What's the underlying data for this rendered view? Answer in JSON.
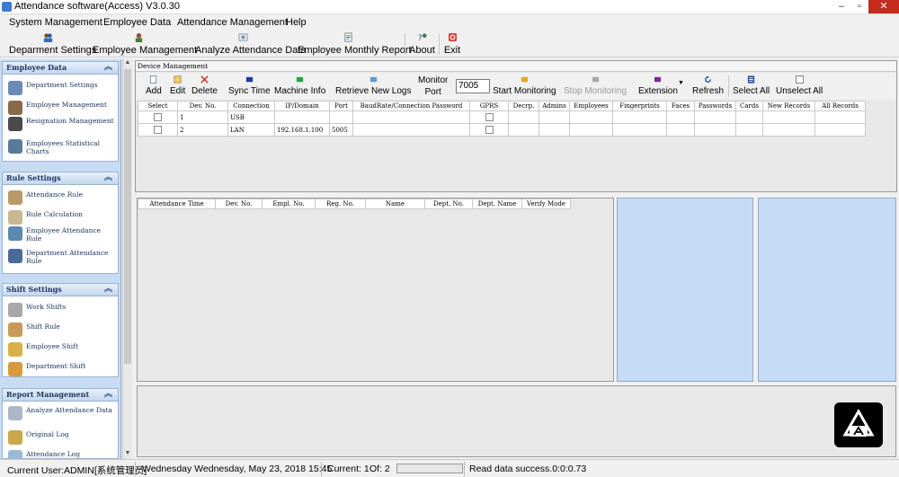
{
  "window": {
    "title": "Attendance software(Access) V3.0.30",
    "buttons": {
      "minimize": "–",
      "maximize": "▫",
      "close": "✕"
    }
  },
  "menu": [
    "System Management",
    "Employee Data",
    "Attendance Management",
    "Help"
  ],
  "toolbar": [
    {
      "label": "Deparment Settings",
      "icon": "department-icon"
    },
    {
      "label": "Employee Management",
      "icon": "employee-icon"
    },
    {
      "label": "Analyze Attendance Data",
      "icon": "analyze-icon"
    },
    {
      "label": "Employee Monthly Report",
      "icon": "report-icon"
    },
    {
      "label": "About",
      "icon": "about-icon"
    },
    {
      "label": "Exit",
      "icon": "exit-icon"
    }
  ],
  "nav": {
    "sections": [
      {
        "title": "Employee Data",
        "items": [
          "Department Settings",
          "Employee Management",
          "Resignation Management",
          "Employees Statistical Charts"
        ]
      },
      {
        "title": "Rule Settings",
        "items": [
          "Attendance Rule",
          "Rule Calculation",
          "Employee Attendance Rule",
          "Department Attendance Rule"
        ]
      },
      {
        "title": "Shift Settings",
        "items": [
          "Work Shifts",
          "Shift Rule",
          "Employee Shift",
          "Department Shift"
        ]
      },
      {
        "title": "Report Management",
        "items": [
          "Analyze Attendance Data",
          "Original Log",
          "Attendance Log"
        ]
      }
    ]
  },
  "device_panel": {
    "title": "Device Management",
    "toolbar": {
      "add": "Add",
      "edit": "Edit",
      "delete": "Delete",
      "sync_time": "Sync Time",
      "machine_info": "Machine Info",
      "retrieve_logs": "Retrieve New Logs",
      "monitor_port_label_1": "Monitor",
      "monitor_port_label_2": "Port",
      "monitor_port_value": "7005",
      "start_monitoring": "Start Monitoring",
      "stop_monitoring": "Stop Monitoring",
      "extension": "Extension",
      "refresh": "Refresh",
      "select_all": "Select All",
      "unselect_all": "Unselect All"
    },
    "columns": [
      "Select",
      "Dev. No.",
      "Connection",
      "IP/Domain",
      "Port",
      "BaudRate/Connection Password",
      "GPRS",
      "Decrp.",
      "Admins",
      "Employees",
      "Fingerprints",
      "Faces",
      "Passwords",
      "Cards",
      "New Records",
      "All Records"
    ],
    "rows": [
      {
        "dev_no": "1",
        "connection": "USB",
        "ip": "",
        "port": ""
      },
      {
        "dev_no": "2",
        "connection": "LAN",
        "ip": "192.168.1.100",
        "port": "5005"
      }
    ]
  },
  "log_table": {
    "columns": [
      "Attendance Time",
      "Dev. No.",
      "Empl. No.",
      "Reg. No.",
      "Name",
      "Dept. No.",
      "Dept. Name",
      "Verify Mode"
    ]
  },
  "status": {
    "user": "Current User:ADMIN[系统管理员]",
    "date": "Wednesday  Wednesday, May 23, 2018 15:45",
    "current": "Current: 1",
    "of": "Of: 2",
    "progress": 0,
    "message": "Read data success.0:0:0.73"
  }
}
